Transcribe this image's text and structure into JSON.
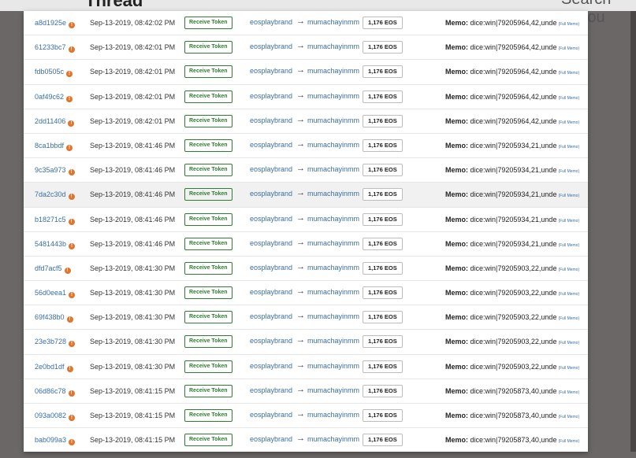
{
  "background": {
    "heading_fragment": "Thread",
    "search_fragment": "Search Accou"
  },
  "labels": {
    "memo_label": "Memo:",
    "full_memo": "(Full Memo)",
    "arrow": "→"
  },
  "rows": [
    {
      "hash": "a8d1925e",
      "time": "Sep-13-2019, 08:42:02 PM",
      "action": "Receive Token",
      "from": "eosplaybrand",
      "to": "mumachayinmm",
      "amount": "1,176 EOS",
      "memo": "dice:win|79205964,42,unde"
    },
    {
      "hash": "61233bc7",
      "time": "Sep-13-2019, 08:42:01 PM",
      "action": "Receive Token",
      "from": "eosplaybrand",
      "to": "mumachayinmm",
      "amount": "1,176 EOS",
      "memo": "dice:win|79205964,42,unde"
    },
    {
      "hash": "fdb0505c",
      "time": "Sep-13-2019, 08:42:01 PM",
      "action": "Receive Token",
      "from": "eosplaybrand",
      "to": "mumachayinmm",
      "amount": "1,176 EOS",
      "memo": "dice:win|79205964,42,unde"
    },
    {
      "hash": "0af49c62",
      "time": "Sep-13-2019, 08:42:01 PM",
      "action": "Receive Token",
      "from": "eosplaybrand",
      "to": "mumachayinmm",
      "amount": "1,176 EOS",
      "memo": "dice:win|79205964,42,unde"
    },
    {
      "hash": "2dd11406",
      "time": "Sep-13-2019, 08:42:01 PM",
      "action": "Receive Token",
      "from": "eosplaybrand",
      "to": "mumachayinmm",
      "amount": "1,176 EOS",
      "memo": "dice:win|79205964,42,unde"
    },
    {
      "hash": "8ca1bbdf",
      "time": "Sep-13-2019, 08:41:46 PM",
      "action": "Receive Token",
      "from": "eosplaybrand",
      "to": "mumachayinmm",
      "amount": "1,176 EOS",
      "memo": "dice:win|79205934,21,unde"
    },
    {
      "hash": "9c35a973",
      "time": "Sep-13-2019, 08:41:46 PM",
      "action": "Receive Token",
      "from": "eosplaybrand",
      "to": "mumachayinmm",
      "amount": "1,176 EOS",
      "memo": "dice:win|79205934,21,unde"
    },
    {
      "hash": "7da2c30d",
      "time": "Sep-13-2019, 08:41:46 PM",
      "action": "Receive Token",
      "from": "eosplaybrand",
      "to": "mumachayinmm",
      "amount": "1,176 EOS",
      "memo": "dice:win|79205934,21,unde"
    },
    {
      "hash": "b18271c5",
      "time": "Sep-13-2019, 08:41:46 PM",
      "action": "Receive Token",
      "from": "eosplaybrand",
      "to": "mumachayinmm",
      "amount": "1,176 EOS",
      "memo": "dice:win|79205934,21,unde"
    },
    {
      "hash": "5481443b",
      "time": "Sep-13-2019, 08:41:46 PM",
      "action": "Receive Token",
      "from": "eosplaybrand",
      "to": "mumachayinmm",
      "amount": "1,176 EOS",
      "memo": "dice:win|79205934,21,unde"
    },
    {
      "hash": "dfd7acf5",
      "time": "Sep-13-2019, 08:41:30 PM",
      "action": "Receive Token",
      "from": "eosplaybrand",
      "to": "mumachayinmm",
      "amount": "1,176 EOS",
      "memo": "dice:win|79205903,22,unde"
    },
    {
      "hash": "56d0eea1",
      "time": "Sep-13-2019, 08:41:30 PM",
      "action": "Receive Token",
      "from": "eosplaybrand",
      "to": "mumachayinmm",
      "amount": "1,176 EOS",
      "memo": "dice:win|79205903,22,unde"
    },
    {
      "hash": "69f438b0",
      "time": "Sep-13-2019, 08:41:30 PM",
      "action": "Receive Token",
      "from": "eosplaybrand",
      "to": "mumachayinmm",
      "amount": "1,176 EOS",
      "memo": "dice:win|79205903,22,unde"
    },
    {
      "hash": "23e3b728",
      "time": "Sep-13-2019, 08:41:30 PM",
      "action": "Receive Token",
      "from": "eosplaybrand",
      "to": "mumachayinmm",
      "amount": "1,176 EOS",
      "memo": "dice:win|79205903,22,unde"
    },
    {
      "hash": "2e0bd1df",
      "time": "Sep-13-2019, 08:41:30 PM",
      "action": "Receive Token",
      "from": "eosplaybrand",
      "to": "mumachayinmm",
      "amount": "1,176 EOS",
      "memo": "dice:win|79205903,22,unde"
    },
    {
      "hash": "06d86c78",
      "time": "Sep-13-2019, 08:41:15 PM",
      "action": "Receive Token",
      "from": "eosplaybrand",
      "to": "mumachayinmm",
      "amount": "1,176 EOS",
      "memo": "dice:win|79205873,40,unde"
    },
    {
      "hash": "093a0082",
      "time": "Sep-13-2019, 08:41:15 PM",
      "action": "Receive Token",
      "from": "eosplaybrand",
      "to": "mumachayinmm",
      "amount": "1,176 EOS",
      "memo": "dice:win|79205873,40,unde"
    },
    {
      "hash": "bab099a3",
      "time": "Sep-13-2019, 08:41:15 PM",
      "action": "Receive Token",
      "from": "eosplaybrand",
      "to": "mumachayinmm",
      "amount": "1,176 EOS",
      "memo": "dice:win|79205873,40,unde"
    }
  ],
  "highlighted_row_hash": "7da2c30d",
  "colors": {
    "link": "#3a6ea5",
    "action_green": "#2e7d32",
    "info_orange": "#e2742b"
  },
  "icons": {
    "info": "clock-icon"
  }
}
